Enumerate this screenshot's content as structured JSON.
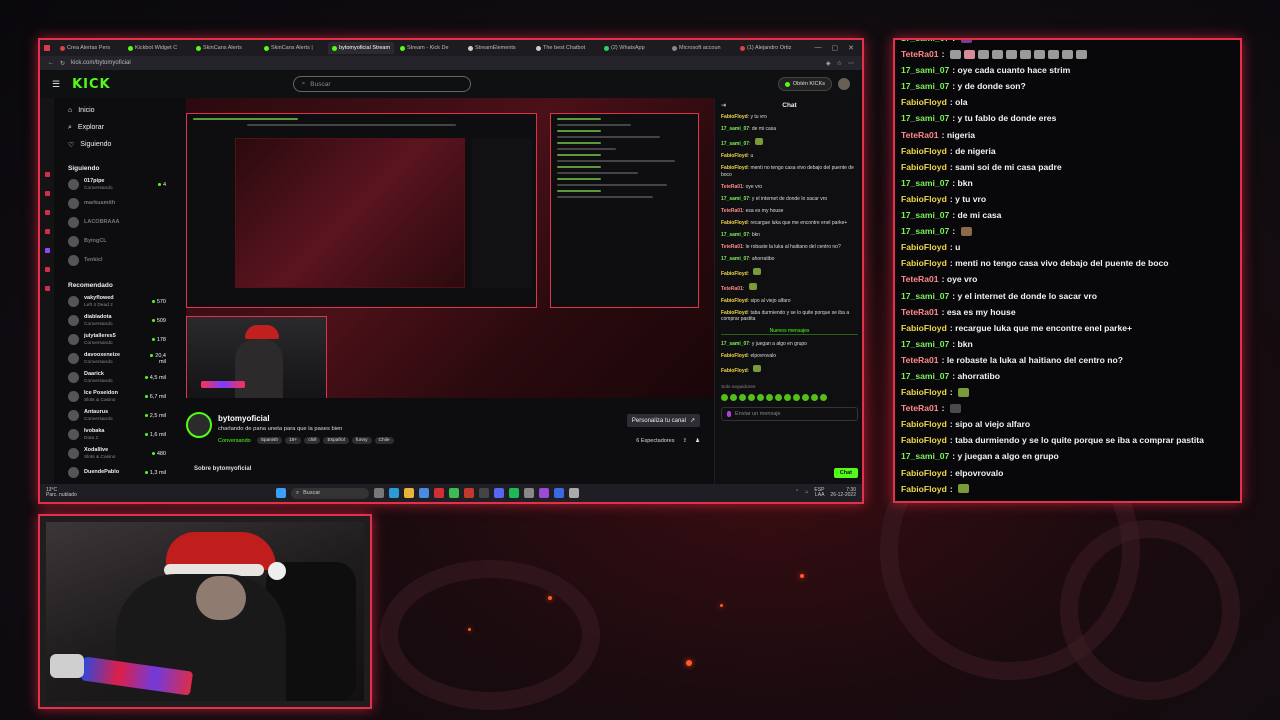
{
  "browser": {
    "tabs": [
      {
        "label": "Crea Alertas Pers",
        "color": "#e04040"
      },
      {
        "label": "Kickbot Widget C",
        "color": "#53fc18"
      },
      {
        "label": "SkinCans Alerts",
        "color": "#53fc18"
      },
      {
        "label": "SkinCans Alerts |",
        "color": "#53fc18"
      },
      {
        "label": "bytomyoficial Stream",
        "color": "#53fc18"
      },
      {
        "label": "Stream - Kick De",
        "color": "#53fc18"
      },
      {
        "label": "StreamElements",
        "color": "#cccccc"
      },
      {
        "label": "The best Chatbot",
        "color": "#cccccc"
      },
      {
        "label": "(2) WhatsApp",
        "color": "#25d366"
      },
      {
        "label": "Microsoft accoun",
        "color": "#888888"
      },
      {
        "label": "(1) Alejandro Ortiz",
        "color": "#e04040"
      }
    ],
    "url": "kick.com/bytomyoficial"
  },
  "kick": {
    "logo": "KICK",
    "search_placeholder": "Buscar",
    "kicks_button": "Obtén KICKs",
    "nav": [
      {
        "label": "Inicio",
        "icon": "⌂"
      },
      {
        "label": "Explorar",
        "icon": "⌕"
      },
      {
        "label": "Siguiendo",
        "icon": "♡"
      }
    ],
    "following_header": "Siguiendo",
    "following": [
      {
        "name": "017pipe",
        "cat": "Conversando",
        "viewers": "4",
        "online": true
      },
      {
        "name": "markuamith",
        "cat": "",
        "viewers": "",
        "online": false
      },
      {
        "name": "LACOBRAAA",
        "cat": "",
        "viewers": "",
        "online": false
      },
      {
        "name": "ByingCL",
        "cat": "",
        "viewers": "",
        "online": false
      },
      {
        "name": "Tenkicl",
        "cat": "",
        "viewers": "",
        "online": false
      }
    ],
    "recommended_header": "Recomendado",
    "recommended": [
      {
        "name": "vakyflowed",
        "cat": "Left 4 Dead 2",
        "viewers": "570"
      },
      {
        "name": "diabladota",
        "cat": "Conversando",
        "viewers": "509"
      },
      {
        "name": "julytalleres5",
        "cat": "Conversando",
        "viewers": "178"
      },
      {
        "name": "davooxeneize",
        "cat": "Conversando",
        "viewers": "20,4 mil"
      },
      {
        "name": "Daarick",
        "cat": "Conversando",
        "viewers": "4,5 mil"
      },
      {
        "name": "Ice Poseidon",
        "cat": "Slots & Casino",
        "viewers": "6,7 mil"
      },
      {
        "name": "Antaurus",
        "cat": "Conversando",
        "viewers": "2,5 mil"
      },
      {
        "name": "Ivobaka",
        "cat": "Dota 2",
        "viewers": "1,6 mil"
      },
      {
        "name": "Xodallive",
        "cat": "Slots & Casino",
        "viewers": "480"
      },
      {
        "name": "DuendePablo",
        "cat": "",
        "viewers": "1,3 mil"
      }
    ],
    "channel": {
      "name": "bytomyoficial",
      "title": "charlando de pana uneta para que la pases bien",
      "category": "Conversando",
      "tags": [
        "Spanish",
        "18+",
        "chill",
        "Español",
        "funny",
        "Chile"
      ],
      "customize_btn": "Personaliza tu canal",
      "viewers": "6 Espectadores",
      "about": "Sobre bytomyoficial"
    },
    "chat": {
      "title": "Chat",
      "messages": [
        {
          "user": "FabioFloyd",
          "text": "y tu vro",
          "c": "#f0d84a"
        },
        {
          "user": "17_sami_07",
          "text": "de mi casa",
          "c": "#7cf05a"
        },
        {
          "user": "17_sami_07",
          "text": "",
          "c": "#7cf05a"
        },
        {
          "user": "FabioFloyd",
          "text": "u",
          "c": "#f0d84a"
        },
        {
          "user": "FabioFloyd",
          "text": "menti no tengo casa vivo debajo del puente de boco",
          "c": "#f0d84a"
        },
        {
          "user": "TeteRa01",
          "text": "oye vro",
          "c": "#ff8a8a"
        },
        {
          "user": "17_sami_07",
          "text": "y el internet de donde lo sacar vro",
          "c": "#7cf05a"
        },
        {
          "user": "TeteRa01",
          "text": "esa es my house",
          "c": "#ff8a8a"
        },
        {
          "user": "FabioFloyd",
          "text": "recargue luka que me encontre enel parke+",
          "c": "#f0d84a"
        },
        {
          "user": "17_sami_07",
          "text": "bkn",
          "c": "#7cf05a"
        },
        {
          "user": "TeteRa01",
          "text": "le robaste la luka al haitiano del centro no?",
          "c": "#ff8a8a"
        },
        {
          "user": "17_sami_07",
          "text": "ahorratibo",
          "c": "#7cf05a"
        },
        {
          "user": "FabioFloyd",
          "text": "",
          "c": "#f0d84a"
        },
        {
          "user": "TeteRa01",
          "text": "",
          "c": "#ff8a8a"
        },
        {
          "user": "FabioFloyd",
          "text": "sipo al viejo alfaro",
          "c": "#f0d84a"
        },
        {
          "user": "FabioFloyd",
          "text": "taba durmiendo y se lo quite porque se iba a comprar pastita",
          "c": "#f0d84a"
        }
      ],
      "new_messages": "Nuevos mensajes",
      "after": [
        {
          "user": "17_sami_07",
          "text": "y juegan a algo en grupo",
          "c": "#7cf05a"
        },
        {
          "user": "FabioFloyd",
          "text": "elpovrovalo",
          "c": "#f0d84a"
        },
        {
          "user": "FabioFloyd",
          "text": "",
          "c": "#f0d84a"
        }
      ],
      "followers_only": "Solo seguidores",
      "input_placeholder": "Enviar un mensaje",
      "send": "Chat"
    },
    "taskbar": {
      "weather_temp": "13°C",
      "weather_desc": "Parc. nublado",
      "search": "Buscar",
      "lang": "ESP",
      "lang2": "LAA",
      "time": "7:30",
      "date": "26-12-2022"
    }
  },
  "overlay_chat": [
    {
      "user": "17_sami_07",
      "text": "",
      "cls": "u-green",
      "emotes": [
        "purple"
      ]
    },
    {
      "user": "TeteRa01",
      "text": "",
      "cls": "u-red",
      "emotes": [
        "gray",
        "pink",
        "gray",
        "gray",
        "gray",
        "gray",
        "gray",
        "gray",
        "gray",
        "gray"
      ]
    },
    {
      "user": "17_sami_07",
      "text": "oye cada cuanto hace strim",
      "cls": "u-green",
      "emotes": []
    },
    {
      "user": "17_sami_07",
      "text": "y de donde son?",
      "cls": "u-green",
      "emotes": []
    },
    {
      "user": "FabioFloyd",
      "text": "ola",
      "cls": "u-yellow",
      "emotes": []
    },
    {
      "user": "17_sami_07",
      "text": "y tu fablo de donde eres",
      "cls": "u-green",
      "emotes": []
    },
    {
      "user": "TeteRa01",
      "text": "nigeria",
      "cls": "u-red",
      "emotes": []
    },
    {
      "user": "FabioFloyd",
      "text": "de nigeria",
      "cls": "u-yellow",
      "emotes": []
    },
    {
      "user": "FabioFloyd",
      "text": "sami soi de mi casa padre",
      "cls": "u-yellow",
      "emotes": []
    },
    {
      "user": "17_sami_07",
      "text": "bkn",
      "cls": "u-green",
      "emotes": []
    },
    {
      "user": "FabioFloyd",
      "text": "y tu vro",
      "cls": "u-yellow",
      "emotes": []
    },
    {
      "user": "17_sami_07",
      "text": "de mi casa",
      "cls": "u-green",
      "emotes": []
    },
    {
      "user": "17_sami_07",
      "text": "",
      "cls": "u-green",
      "emotes": [
        "brown"
      ]
    },
    {
      "user": "FabioFloyd",
      "text": "u",
      "cls": "u-yellow",
      "emotes": []
    },
    {
      "user": "FabioFloyd",
      "text": "menti no tengo casa vivo debajo del puente de boco",
      "cls": "u-yellow",
      "emotes": []
    },
    {
      "user": "TeteRa01",
      "text": "oye vro",
      "cls": "u-red",
      "emotes": []
    },
    {
      "user": "17_sami_07",
      "text": "y el internet de donde lo sacar vro",
      "cls": "u-green",
      "emotes": []
    },
    {
      "user": "TeteRa01",
      "text": "esa es my house",
      "cls": "u-red",
      "emotes": []
    },
    {
      "user": "FabioFloyd",
      "text": "recargue luka que me encontre enel parke+",
      "cls": "u-yellow",
      "emotes": []
    },
    {
      "user": "17_sami_07",
      "text": "bkn",
      "cls": "u-green",
      "emotes": []
    },
    {
      "user": "TeteRa01",
      "text": "le robaste la luka al haitiano del centro no?",
      "cls": "u-red",
      "emotes": []
    },
    {
      "user": "17_sami_07",
      "text": "ahorratibo",
      "cls": "u-green",
      "emotes": []
    },
    {
      "user": "FabioFloyd",
      "text": "",
      "cls": "u-yellow",
      "emotes": [
        "green"
      ]
    },
    {
      "user": "TeteRa01",
      "text": "",
      "cls": "u-red",
      "emotes": [
        "dark"
      ]
    },
    {
      "user": "FabioFloyd",
      "text": "sipo al viejo alfaro",
      "cls": "u-yellow",
      "emotes": []
    },
    {
      "user": "FabioFloyd",
      "text": "taba durmiendo y se lo quite porque se iba a comprar pastita",
      "cls": "u-yellow",
      "emotes": []
    },
    {
      "user": "17_sami_07",
      "text": "y juegan a algo en grupo",
      "cls": "u-green",
      "emotes": []
    },
    {
      "user": "FabioFloyd",
      "text": "elpovrovalo",
      "cls": "u-yellow",
      "emotes": []
    },
    {
      "user": "FabioFloyd",
      "text": "",
      "cls": "u-yellow",
      "emotes": [
        "green"
      ]
    }
  ]
}
